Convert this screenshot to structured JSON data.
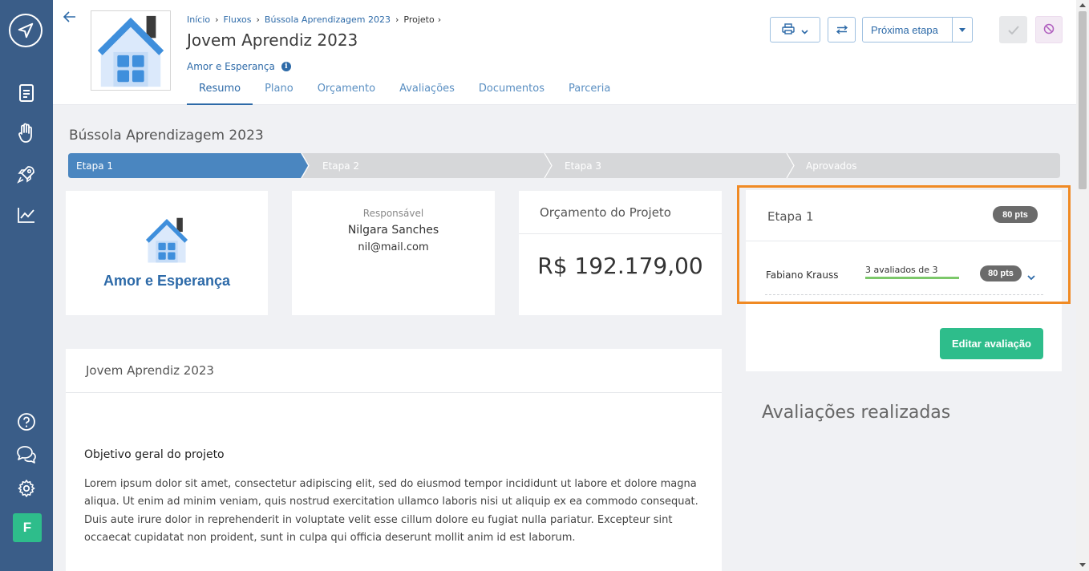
{
  "breadcrumb": [
    "Início",
    "Fluxos",
    "Bússola Aprendizagem 2023",
    "Projeto"
  ],
  "header": {
    "title": "Jovem Aprendiz 2023",
    "organization": "Amor e Esperança",
    "info_icon": "info-icon",
    "next_step_label": "Próxima etapa"
  },
  "tabs": [
    {
      "label": "Resumo",
      "active": true
    },
    {
      "label": "Plano",
      "active": false
    },
    {
      "label": "Orçamento",
      "active": false
    },
    {
      "label": "Avaliações",
      "active": false
    },
    {
      "label": "Documentos",
      "active": false
    },
    {
      "label": "Parceria",
      "active": false
    }
  ],
  "sidebar": {
    "icons": [
      "logo-send-icon",
      "document-icon",
      "hand-heart-icon",
      "rocket-icon",
      "chart-icon",
      "help-icon",
      "chat-icon",
      "gear-icon"
    ],
    "user_initial": "F"
  },
  "flow": {
    "title": "Bússola Aprendizagem 2023",
    "steps": [
      {
        "label": "Etapa 1",
        "active": true
      },
      {
        "label": "Etapa 2",
        "active": false
      },
      {
        "label": "Etapa 3",
        "active": false
      },
      {
        "label": "Aprovados",
        "active": false
      }
    ]
  },
  "organization_card": {
    "name": "Amor e Esperança"
  },
  "responsible_card": {
    "label": "Responsável",
    "name": "Nilgara Sanches",
    "email": "nil@mail.com"
  },
  "budget_card": {
    "label": "Orçamento do Projeto",
    "value": "R$ 192.179,00"
  },
  "description_card": {
    "title": "Jovem Aprendiz 2023",
    "subtitle": "Objetivo geral do projeto",
    "text": "Lorem ipsum dolor sit amet, consectetur adipiscing elit, sed do eiusmod tempor incididunt ut labore et dolore magna aliqua. Ut enim ad minim veniam, quis nostrud exercitation ullamco laboris nisi ut aliquip ex ea commodo consequat. Duis aute irure dolor in reprehenderit in voluptate velit esse cillum dolore eu fugiat nulla pariatur. Excepteur sint occaecat cupidatat non proident, sunt in culpa qui officia deserunt mollit anim id est laborum."
  },
  "evaluation": {
    "title": "Etapa 1",
    "score": "80 pts",
    "rows": [
      {
        "name": "Fabiano Krauss",
        "progress_text": "3 avaliados de 3",
        "progress": 1.0,
        "score": "80 pts"
      }
    ],
    "edit_label": "Editar avaliação"
  },
  "completed_title": "Avaliações realizadas",
  "colors": {
    "sidebar": "#3a5d88",
    "primary": "#2d6aa8",
    "success": "#2ebd8b",
    "step_active": "#4a86c0",
    "step_inactive": "#d6d7d9",
    "highlight": "#f08a24"
  }
}
